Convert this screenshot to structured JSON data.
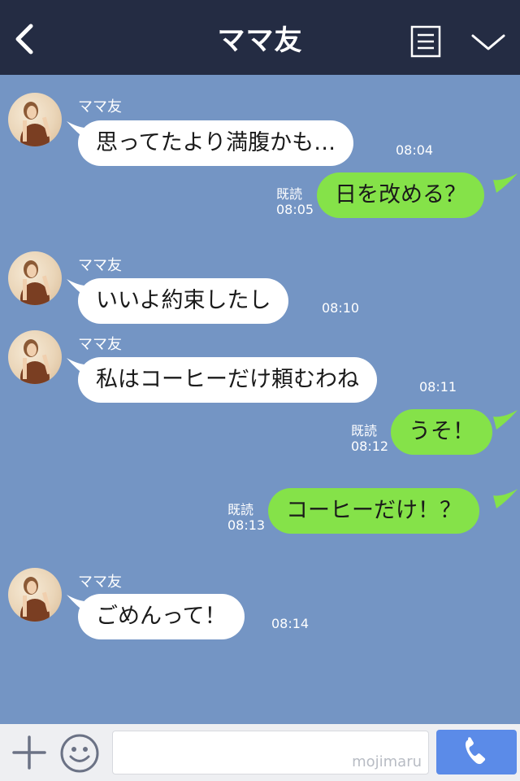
{
  "header": {
    "title": "ママ友"
  },
  "messages": [
    {
      "sender": "ママ友",
      "text": "思ってたより満腹かも…",
      "time": "08:04"
    },
    {
      "read": "既読",
      "time": "08:05",
      "text": "日を改める？"
    },
    {
      "sender": "ママ友",
      "text": "いいよ約束したし",
      "time": "08:10"
    },
    {
      "sender": "ママ友",
      "text": "私はコーヒーだけ頼むわね",
      "time": "08:11"
    },
    {
      "read": "既読",
      "time": "08:12",
      "text": "うそ！"
    },
    {
      "read": "既読",
      "time": "08:13",
      "text": "コーヒーだけ！？"
    },
    {
      "sender": "ママ友",
      "text": "ごめんって！",
      "time": "08:14"
    }
  ],
  "footer": {
    "watermark": "mojimaru"
  },
  "colors": {
    "header_bg": "#242c43",
    "chat_bg": "#7495c4",
    "incoming_bubble": "#ffffff",
    "outgoing_bubble": "#85e249",
    "call_button": "#5b8be8"
  },
  "icons": [
    "back-arrow-icon",
    "menu-icon",
    "chevron-down-icon",
    "plus-icon",
    "emoji-icon",
    "phone-icon",
    "avatar"
  ]
}
